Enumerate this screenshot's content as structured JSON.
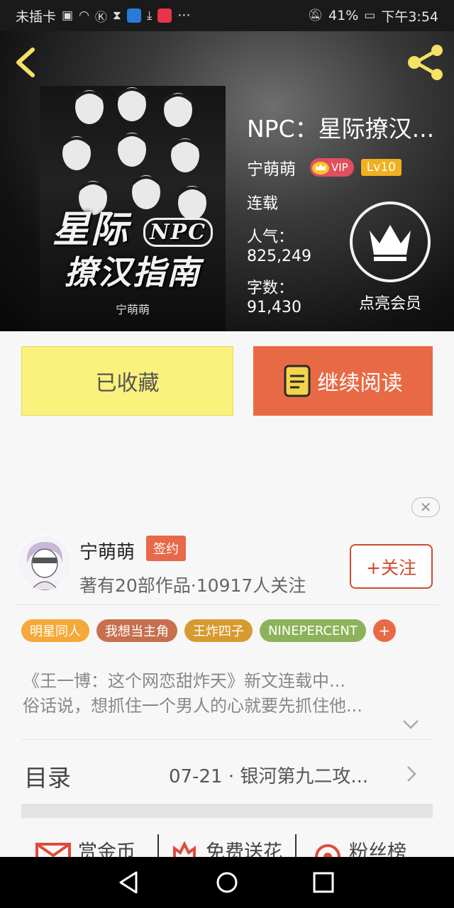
{
  "status_bar": {
    "carrier": "未插卡",
    "battery": "41%",
    "time": "下午3:54",
    "more": "···"
  },
  "header": {
    "book_title": "NPC：星际撩汉...",
    "author": "宁萌萌",
    "vip_label": "VIP",
    "level": "Lv10",
    "status": "连载",
    "popularity_label": "人气：",
    "popularity_value": "825,249",
    "words_label": "字数：",
    "words_value": "91,430",
    "member_label": "点亮会员",
    "cover": {
      "title_line1": "星际",
      "title_badge": "NPC",
      "title_line2": "撩汉指南",
      "author": "宁萌萌"
    }
  },
  "actions": {
    "favorited": "已收藏",
    "continue_reading": "继续阅读"
  },
  "author_card": {
    "name": "宁萌萌",
    "signed": "签约",
    "summary": "著有20部作品·10917人关注",
    "follow": "+关注"
  },
  "tags": [
    {
      "label": "明星同人",
      "color": "#f5a93a"
    },
    {
      "label": "我想当主角",
      "color": "#c7704f"
    },
    {
      "label": "王炸四子",
      "color": "#d79a2f"
    },
    {
      "label": "NINEPERCENT",
      "color": "#8db35a"
    }
  ],
  "tag_add": "+",
  "intro": {
    "line1": "《王一博：这个网恋甜炸天》新文连载中...",
    "line2": "俗话说，想抓住一个男人的心就要先抓住他..."
  },
  "toc": {
    "label": "目录",
    "latest": "07-21 · 银河第九二攻..."
  },
  "bottom_tabs": {
    "coins": "赏金币",
    "flowers": "免费送花",
    "fans": "粉丝榜"
  },
  "colors": {
    "accent": "#e86a44",
    "favorite_bg": "#fbf17d",
    "share_icon": "#f5e163"
  },
  "icons": [
    "back-arrow-icon",
    "share-icon",
    "crown-icon",
    "book-icon",
    "close-icon",
    "chevron-down-icon",
    "chevron-right-icon",
    "envelope-icon",
    "flower-icon",
    "target-icon"
  ]
}
